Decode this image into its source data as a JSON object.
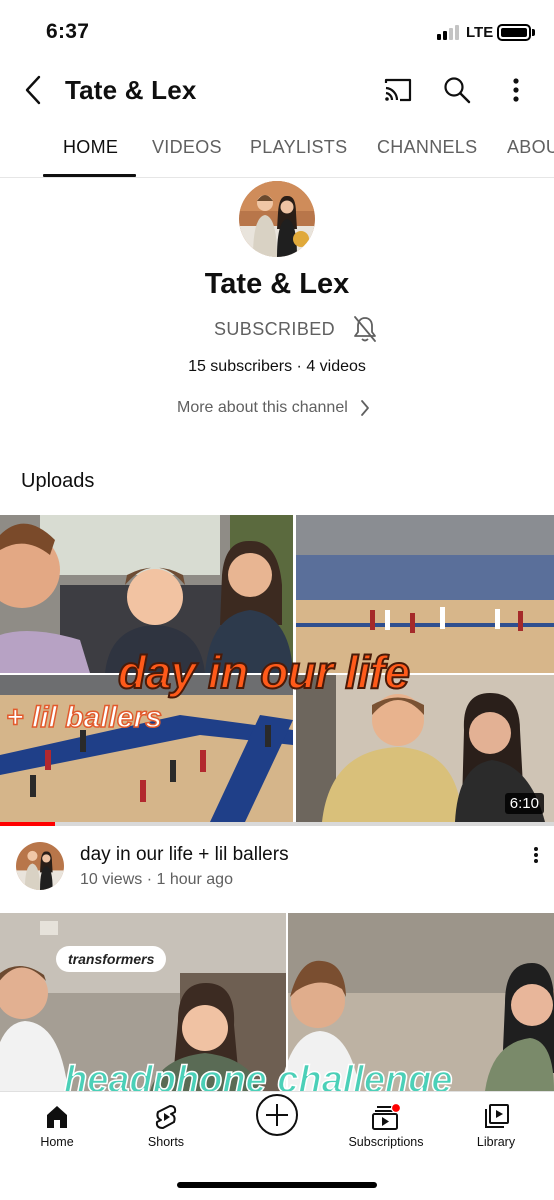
{
  "status_bar": {
    "time": "6:37",
    "network": "LTE"
  },
  "header": {
    "title": "Tate & Lex"
  },
  "tabs": [
    {
      "label": "HOME"
    },
    {
      "label": "VIDEOS"
    },
    {
      "label": "PLAYLISTS"
    },
    {
      "label": "CHANNELS"
    },
    {
      "label": "ABOUT"
    }
  ],
  "channel": {
    "name": "Tate & Lex",
    "subscribe_label": "SUBSCRIBED",
    "stats": "15 subscribers · 4 videos",
    "more_about_label": "More about this channel"
  },
  "uploads": {
    "heading": "Uploads",
    "videos": [
      {
        "title": "day in our life + lil ballers",
        "meta": "10 views · 1 hour ago",
        "duration": "6:10",
        "thumbnail_text": [
          "day in our life",
          "+ lil ballers"
        ],
        "watched_fraction": 0.1
      },
      {
        "thumbnail_text": [
          "transformers",
          "headphone challenge"
        ]
      }
    ]
  },
  "bottom_nav": [
    {
      "label": "Home",
      "icon": "home-icon"
    },
    {
      "label": "Shorts",
      "icon": "shorts-icon"
    },
    {
      "label": "",
      "icon": "create-icon"
    },
    {
      "label": "Subscriptions",
      "icon": "subscriptions-icon"
    },
    {
      "label": "Library",
      "icon": "library-icon"
    }
  ],
  "colors": {
    "accent_red": "#ff0000",
    "text_primary": "#0f0f0f",
    "text_secondary": "#606060"
  }
}
